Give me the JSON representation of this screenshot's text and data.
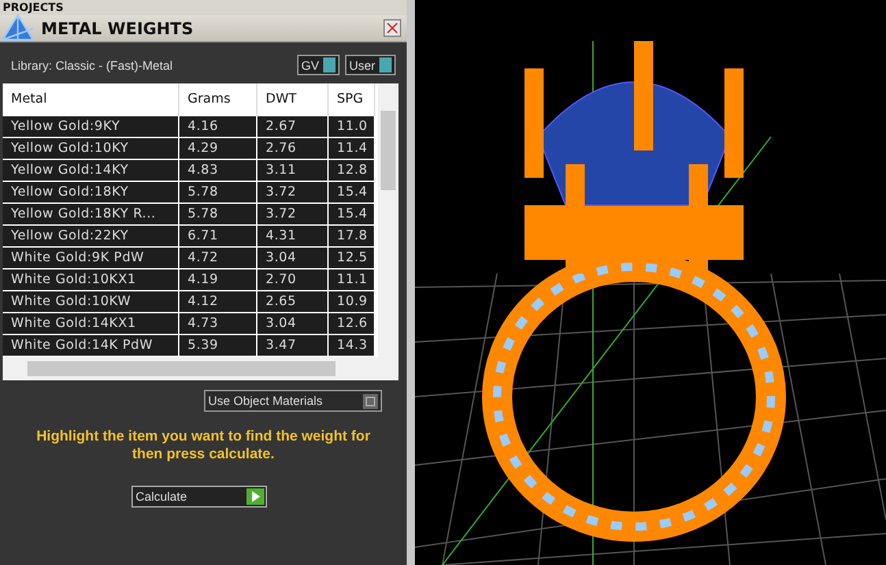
{
  "header": {
    "title": "PROJECTS"
  },
  "panel": {
    "title": "METAL WEIGHTS",
    "library": "Library: Classic - (Fast)-Metal",
    "toggles": [
      {
        "label": "GV",
        "on": true
      },
      {
        "label": "User",
        "on": true
      }
    ]
  },
  "table": {
    "columns": [
      "Metal",
      "Grams",
      "DWT",
      "SPG"
    ],
    "rows": [
      [
        "Yellow Gold:9KY",
        "4.16",
        "2.67",
        "11.0"
      ],
      [
        "Yellow Gold:10KY",
        "4.29",
        "2.76",
        "11.4"
      ],
      [
        "Yellow Gold:14KY",
        "4.83",
        "3.11",
        "12.8"
      ],
      [
        "Yellow Gold:18KY",
        "5.78",
        "3.72",
        "15.4"
      ],
      [
        "Yellow Gold:18KY R...",
        "5.78",
        "3.72",
        "15.4"
      ],
      [
        "Yellow Gold:22KY",
        "6.71",
        "4.31",
        "17.8"
      ],
      [
        "White Gold:9K PdW",
        "4.72",
        "3.04",
        "12.5"
      ],
      [
        "White Gold:10KX1",
        "4.19",
        "2.70",
        "11.1"
      ],
      [
        "White Gold:10KW",
        "4.12",
        "2.65",
        "10.9"
      ],
      [
        "White Gold:14KX1",
        "4.73",
        "3.04",
        "12.6"
      ],
      [
        "White Gold:14K PdW",
        "5.39",
        "3.47",
        "14.3"
      ]
    ]
  },
  "options": [
    {
      "label": "Use Object Materials",
      "on": false
    }
  ],
  "hint": "Highlight the item you want to find the weight for then press calculate.",
  "calculate_button": "Calculate"
}
